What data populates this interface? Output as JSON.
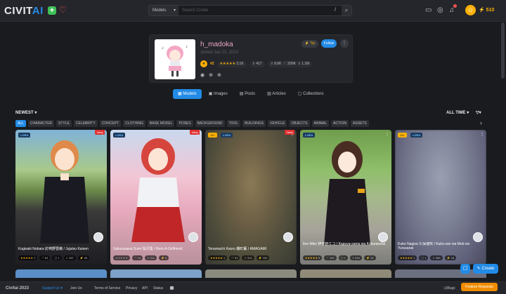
{
  "header": {
    "logo_main": "CIVIT",
    "logo_ai": "AI",
    "plus_icon": "plus-icon",
    "heart_icon": "heart-icon",
    "search_select": "Models",
    "search_placeholder": "Search Civitai",
    "search_shortcut": "/",
    "buzz_amount": "510"
  },
  "profile": {
    "username": "h_madoka",
    "joined": "Joined Jan 22, 2023",
    "tip_label": "Tip",
    "follow_label": "Follow",
    "rank": "#2",
    "rating_count": "3.1K",
    "uploads": "417",
    "downloads_profile": "8.6K",
    "likes": "200K",
    "downloads": "1.1M"
  },
  "tabs": [
    {
      "label": "Models",
      "active": true
    },
    {
      "label": "Images",
      "active": false
    },
    {
      "label": "Posts",
      "active": false
    },
    {
      "label": "Articles",
      "active": false
    },
    {
      "label": "Collections",
      "active": false
    }
  ],
  "sort_label": "NEWEST",
  "period_label": "ALL TIME",
  "chips": [
    "ALL",
    "CHARACTER",
    "STYLE",
    "CELEBRITY",
    "CONCEPT",
    "CLOTHING",
    "BASE MODEL",
    "POSES",
    "BACKGROUND",
    "TOOL",
    "BUILDINGS",
    "VEHICLE",
    "OBJECTS",
    "ANIMAL",
    "ACTION",
    "ASSETS"
  ],
  "cards": [
    {
      "title": "Kugisaki Nobara 釘崎野薔薇 / Jujutsu Kaisen",
      "badge": "LORA",
      "new": true,
      "mature": false,
      "rating": "2",
      "favs": "81",
      "comments": "1",
      "downloads": "287",
      "likes": "60"
    },
    {
      "title": "Sakurasawa Sumi 桜沢墨 / Rent-A-Girlfriend",
      "badge": "LORA",
      "new": true,
      "mature": false,
      "rating": "",
      "favs": "14",
      "comments": "",
      "downloads": "211",
      "likes": "5"
    },
    {
      "title": "Tenamachi Kaoru 棚町薫 / AMAGAMI",
      "badge": "LORA",
      "new": true,
      "mature": true,
      "age": "13+",
      "rating": "1",
      "favs": "91",
      "comments": "",
      "downloads": "312",
      "likes": "100"
    },
    {
      "title": "Iino Miko 伊井野ミコ / Kaguya-sama wa Kokurasetai",
      "badge": "LORA",
      "new": false,
      "mature": false,
      "rating": "5",
      "favs": "162",
      "comments": "1",
      "downloads": "644",
      "likes": "10"
    },
    {
      "title": "Kubo Nagisa 久保渚咲 / Kubo-san wa Mob wo Yurusanai",
      "badge": "LORA",
      "new": false,
      "mature": true,
      "age": "13+",
      "rating": "1",
      "favs": "",
      "comments": "1",
      "downloads": "386",
      "likes": "18"
    }
  ],
  "footer": {
    "copyright": "Civitai 2023",
    "support": "Support Us ♥",
    "join": "Join Us",
    "terms": "Terms of Service",
    "privacy": "Privacy",
    "api": "API",
    "status": "Status",
    "bugs": "Bugs",
    "feature": "Feature Requests",
    "create": "Create"
  }
}
